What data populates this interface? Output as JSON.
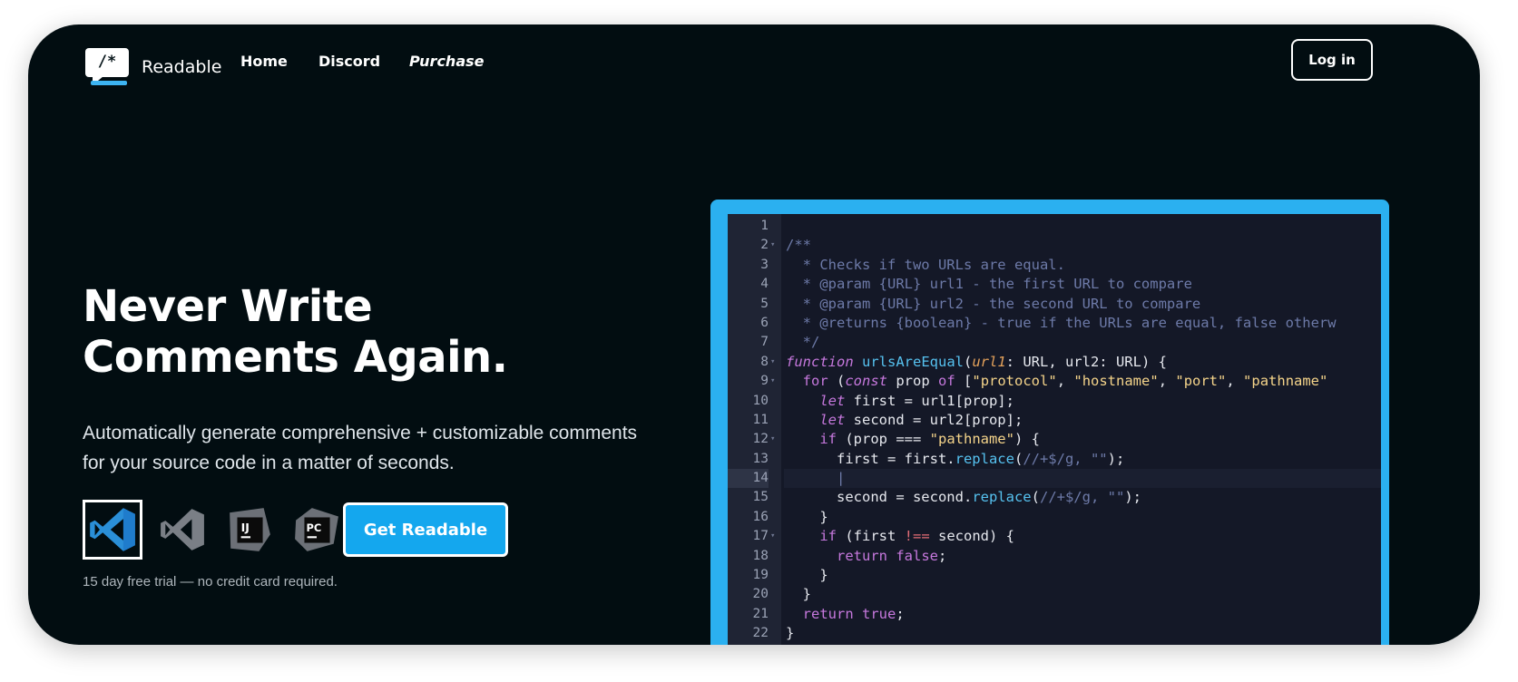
{
  "brand": {
    "name": "Readable",
    "logo_glyph": "/*",
    "accent": "#3db4f2"
  },
  "nav": {
    "links": [
      {
        "label": "Home"
      },
      {
        "label": "Discord"
      },
      {
        "label": "Purchase"
      }
    ],
    "login_label": "Log in"
  },
  "hero": {
    "title_line1": "Never Write",
    "title_line2": "Comments Again.",
    "subtitle": "Automatically generate comprehensive + customizable comments for your source code in a matter of seconds.",
    "ide_icons": [
      {
        "name": "vscode-icon",
        "selected": true
      },
      {
        "name": "visual-studio-icon",
        "selected": false
      },
      {
        "name": "intellij-icon",
        "label": "IJ",
        "selected": false
      },
      {
        "name": "pycharm-icon",
        "label": "PC",
        "selected": false
      }
    ],
    "cta_label": "Get Readable",
    "trial_text": "15 day free trial — no credit card required."
  },
  "colors": {
    "background": "#020d11",
    "cta": "#14a7ee",
    "editor_border": "#2bb0f0",
    "editor_bg": "#141827"
  },
  "editor": {
    "lines": [
      {
        "n": "1",
        "fold": false,
        "tokens": []
      },
      {
        "n": "2",
        "fold": true,
        "tokens": [
          [
            "cm",
            "/**"
          ]
        ]
      },
      {
        "n": "3",
        "fold": false,
        "tokens": [
          [
            "cm",
            "  * Checks if two URLs are equal."
          ]
        ]
      },
      {
        "n": "4",
        "fold": false,
        "tokens": [
          [
            "cm",
            "  * @param {URL} url1 - the first URL to compare"
          ]
        ]
      },
      {
        "n": "5",
        "fold": false,
        "tokens": [
          [
            "cm",
            "  * @param {URL} url2 - the second URL to compare"
          ]
        ]
      },
      {
        "n": "6",
        "fold": false,
        "tokens": [
          [
            "cm",
            "  * @returns {boolean} - true if the URLs are equal, false otherw"
          ]
        ]
      },
      {
        "n": "7",
        "fold": false,
        "tokens": [
          [
            "cm",
            "  */"
          ]
        ]
      },
      {
        "n": "8",
        "fold": true,
        "tokens": [
          [
            "kw",
            "function"
          ],
          [
            "pl",
            " "
          ],
          [
            "fn",
            "urlsAreEqual"
          ],
          [
            "pl",
            "("
          ],
          [
            "prm",
            "url1"
          ],
          [
            "pl",
            ": URL, url2: URL) {"
          ]
        ]
      },
      {
        "n": "9",
        "fold": true,
        "tokens": [
          [
            "kw2",
            "  for"
          ],
          [
            "pl",
            " ("
          ],
          [
            "kw",
            "const"
          ],
          [
            "pl",
            " prop "
          ],
          [
            "kw2",
            "of"
          ],
          [
            "pl",
            " ["
          ],
          [
            "str",
            "\"protocol\""
          ],
          [
            "pl",
            ", "
          ],
          [
            "str",
            "\"hostname\""
          ],
          [
            "pl",
            ", "
          ],
          [
            "str",
            "\"port\""
          ],
          [
            "pl",
            ", "
          ],
          [
            "str",
            "\"pathname\""
          ]
        ]
      },
      {
        "n": "10",
        "fold": false,
        "tokens": [
          [
            "kw",
            "    let"
          ],
          [
            "pl",
            " first = url1[prop];"
          ]
        ]
      },
      {
        "n": "11",
        "fold": false,
        "tokens": [
          [
            "kw",
            "    let"
          ],
          [
            "pl",
            " second = url2[prop];"
          ]
        ]
      },
      {
        "n": "12",
        "fold": true,
        "tokens": [
          [
            "kw2",
            "    if"
          ],
          [
            "pl",
            " (prop === "
          ],
          [
            "str",
            "\"pathname\""
          ],
          [
            "pl",
            ") {"
          ]
        ]
      },
      {
        "n": "13",
        "fold": false,
        "tokens": [
          [
            "pl",
            "      first = first."
          ],
          [
            "fn",
            "replace"
          ],
          [
            "pl",
            "("
          ],
          [
            "cm",
            "//+$/g, \"\""
          ],
          [
            "pl",
            ");"
          ]
        ]
      },
      {
        "n": "14",
        "fold": false,
        "active": true,
        "tokens": [
          [
            "cm",
            "      |"
          ]
        ]
      },
      {
        "n": "15",
        "fold": false,
        "tokens": [
          [
            "pl",
            "      second = second."
          ],
          [
            "fn",
            "replace"
          ],
          [
            "pl",
            "("
          ],
          [
            "cm",
            "//+$/g, \"\""
          ],
          [
            "pl",
            ");"
          ]
        ]
      },
      {
        "n": "16",
        "fold": false,
        "tokens": [
          [
            "pl",
            "    }"
          ]
        ]
      },
      {
        "n": "17",
        "fold": true,
        "tokens": [
          [
            "kw2",
            "    if"
          ],
          [
            "pl",
            " (first "
          ],
          [
            "var",
            "!=="
          ],
          [
            "pl",
            " second) {"
          ]
        ]
      },
      {
        "n": "18",
        "fold": false,
        "tokens": [
          [
            "kw2",
            "      return"
          ],
          [
            "pl",
            " "
          ],
          [
            "bool",
            "false"
          ],
          [
            "pl",
            ";"
          ]
        ]
      },
      {
        "n": "19",
        "fold": false,
        "tokens": [
          [
            "pl",
            "    }"
          ]
        ]
      },
      {
        "n": "20",
        "fold": false,
        "tokens": [
          [
            "pl",
            "  }"
          ]
        ]
      },
      {
        "n": "21",
        "fold": false,
        "tokens": [
          [
            "kw2",
            "  return"
          ],
          [
            "pl",
            " "
          ],
          [
            "bool",
            "true"
          ],
          [
            "pl",
            ";"
          ]
        ]
      },
      {
        "n": "22",
        "fold": false,
        "tokens": [
          [
            "pl",
            "}"
          ]
        ]
      }
    ]
  }
}
